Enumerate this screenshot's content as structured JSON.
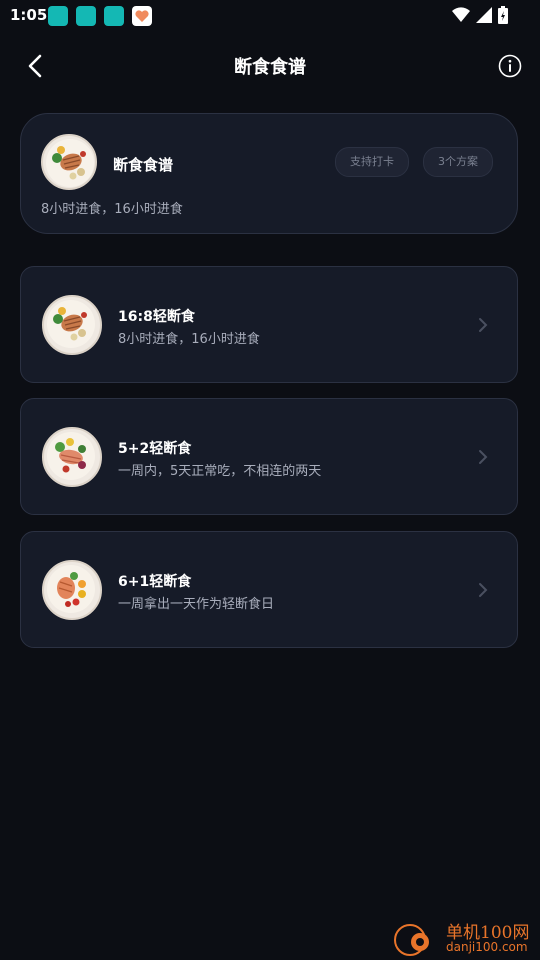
{
  "status_bar": {
    "time": "1:05",
    "icons": [
      "app-icon",
      "app-icon",
      "app-icon",
      "heart-app-icon",
      "wifi-icon",
      "signal-icon",
      "battery-icon"
    ]
  },
  "header": {
    "title": "断食食谱",
    "back_icon": "back-arrow-icon",
    "info_icon": "info-icon"
  },
  "hero": {
    "title": "断食食谱",
    "subtitle": "8小时进食，16小时进食",
    "tags": [
      "支持打卡",
      "3个方案"
    ]
  },
  "plans": [
    {
      "title": "16:8轻断食",
      "subtitle": "8小时进食，16小时进食"
    },
    {
      "title": "5+2轻断食",
      "subtitle": "一周内，5天正常吃，不相连的两天"
    },
    {
      "title": "6+1轻断食",
      "subtitle": "一周拿出一天作为轻断食日"
    }
  ],
  "watermark": {
    "name": "单机100网",
    "url": "danji100.com"
  },
  "colors": {
    "background": "#0c0e14",
    "card": "#161b28",
    "card_border": "#2b3142",
    "accent_watermark": "#e8742a"
  }
}
